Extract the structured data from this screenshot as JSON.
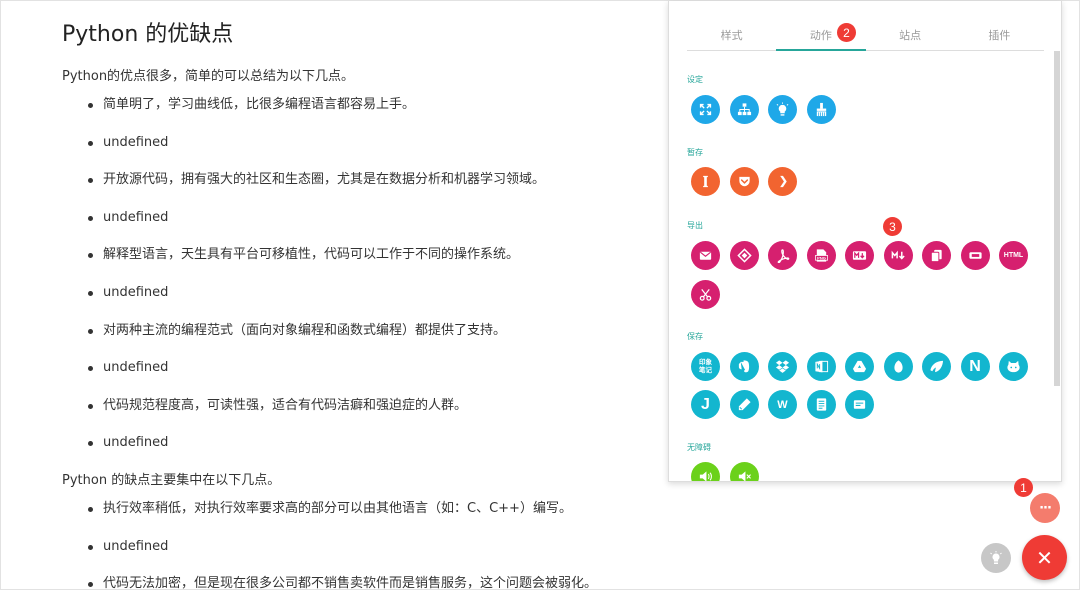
{
  "article": {
    "title": "Python 的优缺点",
    "intro": "Python的优点很多，简单的可以总结为以下几点。",
    "pros": [
      "简单明了，学习曲线低，比很多编程语言都容易上手。",
      "undefined",
      "开放源代码，拥有强大的社区和生态圈，尤其是在数据分析和机器学习领域。",
      "undefined",
      "解释型语言，天生具有平台可移植性，代码可以工作于不同的操作系统。",
      "undefined",
      "对两种主流的编程范式（面向对象编程和函数式编程）都提供了支持。",
      "undefined",
      "代码规范程度高，可读性强，适合有代码洁癖和强迫症的人群。",
      "undefined"
    ],
    "cons_intro": "Python 的缺点主要集中在以下几点。",
    "cons": [
      "执行效率稍低，对执行效率要求高的部分可以由其他语言（如：C、C++）编写。",
      "undefined",
      "代码无法加密，但是现在很多公司都不销售卖软件而是销售服务，这个问题会被弱化。"
    ]
  },
  "panel": {
    "tabs": [
      "样式",
      "动作",
      "站点",
      "插件"
    ],
    "active_tab": "动作",
    "tab_badge": "2",
    "sections": {
      "settings": {
        "label": "设定",
        "icons": [
          "fullscreen-icon",
          "sitemap-icon",
          "lightbulb-icon",
          "brush-icon"
        ]
      },
      "stash": {
        "label": "暂存",
        "icons": [
          "instapaper-icon",
          "pocket-icon",
          "linnk-icon"
        ]
      },
      "export": {
        "label": "导出",
        "icons": [
          "email-icon",
          "epub-icon",
          "pdf-icon",
          "png-icon",
          "markdown-icon",
          "markdown-download-icon",
          "copy-icon",
          "screenshot-icon",
          "html-icon",
          "scissors-icon"
        ],
        "png_text": "PNG",
        "html_text": "HTML",
        "step_badge": "3"
      },
      "save": {
        "label": "保存",
        "icons": [
          "yinxiang-icon",
          "evernote-icon",
          "dropbox-icon",
          "onenote-icon",
          "google-drive-icon",
          "leaf-icon",
          "wing-icon",
          "notion-icon",
          "github-cat-icon",
          "jianguo-icon",
          "pencil-icon",
          "wiz-icon",
          "book-icon",
          "card-icon"
        ],
        "yinxiang_text": "印象\n笔记",
        "notion_text": "N",
        "jianguo_text": "J",
        "wiz_text": "W"
      },
      "accessibility": {
        "label": "无障碍",
        "icons": [
          "speaker-on-icon",
          "speaker-off-icon"
        ]
      }
    }
  },
  "fab": {
    "count_badge": "1",
    "more_label": "···",
    "close_label": "✕"
  },
  "colors": {
    "accent": "#26a69a",
    "badge": "#ef3b35",
    "blue": "#1fa8e8",
    "orange": "#f26430",
    "pink": "#d6206f",
    "cyan": "#13b6cf",
    "green": "#6bd11b"
  }
}
